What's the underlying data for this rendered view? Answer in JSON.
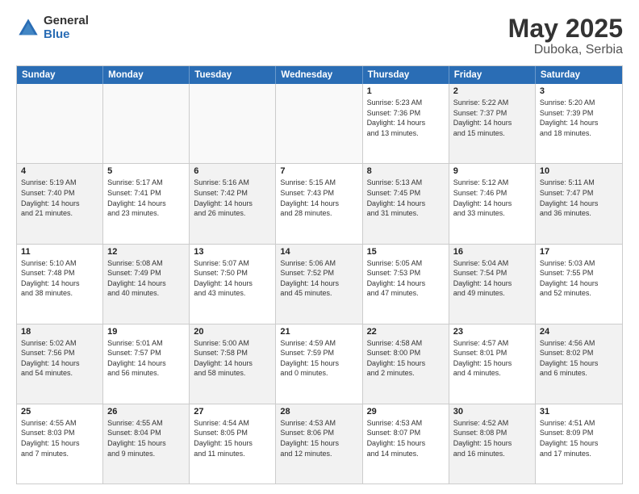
{
  "logo": {
    "general": "General",
    "blue": "Blue"
  },
  "title": "May 2025",
  "subtitle": "Duboka, Serbia",
  "header_days": [
    "Sunday",
    "Monday",
    "Tuesday",
    "Wednesday",
    "Thursday",
    "Friday",
    "Saturday"
  ],
  "weeks": [
    [
      {
        "day": "",
        "content": "",
        "empty": true
      },
      {
        "day": "",
        "content": "",
        "empty": true
      },
      {
        "day": "",
        "content": "",
        "empty": true
      },
      {
        "day": "",
        "content": "",
        "empty": true
      },
      {
        "day": "1",
        "content": "Sunrise: 5:23 AM\nSunset: 7:36 PM\nDaylight: 14 hours\nand 13 minutes.",
        "shaded": false
      },
      {
        "day": "2",
        "content": "Sunrise: 5:22 AM\nSunset: 7:37 PM\nDaylight: 14 hours\nand 15 minutes.",
        "shaded": true
      },
      {
        "day": "3",
        "content": "Sunrise: 5:20 AM\nSunset: 7:39 PM\nDaylight: 14 hours\nand 18 minutes.",
        "shaded": false
      }
    ],
    [
      {
        "day": "4",
        "content": "Sunrise: 5:19 AM\nSunset: 7:40 PM\nDaylight: 14 hours\nand 21 minutes.",
        "shaded": true
      },
      {
        "day": "5",
        "content": "Sunrise: 5:17 AM\nSunset: 7:41 PM\nDaylight: 14 hours\nand 23 minutes.",
        "shaded": false
      },
      {
        "day": "6",
        "content": "Sunrise: 5:16 AM\nSunset: 7:42 PM\nDaylight: 14 hours\nand 26 minutes.",
        "shaded": true
      },
      {
        "day": "7",
        "content": "Sunrise: 5:15 AM\nSunset: 7:43 PM\nDaylight: 14 hours\nand 28 minutes.",
        "shaded": false
      },
      {
        "day": "8",
        "content": "Sunrise: 5:13 AM\nSunset: 7:45 PM\nDaylight: 14 hours\nand 31 minutes.",
        "shaded": true
      },
      {
        "day": "9",
        "content": "Sunrise: 5:12 AM\nSunset: 7:46 PM\nDaylight: 14 hours\nand 33 minutes.",
        "shaded": false
      },
      {
        "day": "10",
        "content": "Sunrise: 5:11 AM\nSunset: 7:47 PM\nDaylight: 14 hours\nand 36 minutes.",
        "shaded": true
      }
    ],
    [
      {
        "day": "11",
        "content": "Sunrise: 5:10 AM\nSunset: 7:48 PM\nDaylight: 14 hours\nand 38 minutes.",
        "shaded": false
      },
      {
        "day": "12",
        "content": "Sunrise: 5:08 AM\nSunset: 7:49 PM\nDaylight: 14 hours\nand 40 minutes.",
        "shaded": true
      },
      {
        "day": "13",
        "content": "Sunrise: 5:07 AM\nSunset: 7:50 PM\nDaylight: 14 hours\nand 43 minutes.",
        "shaded": false
      },
      {
        "day": "14",
        "content": "Sunrise: 5:06 AM\nSunset: 7:52 PM\nDaylight: 14 hours\nand 45 minutes.",
        "shaded": true
      },
      {
        "day": "15",
        "content": "Sunrise: 5:05 AM\nSunset: 7:53 PM\nDaylight: 14 hours\nand 47 minutes.",
        "shaded": false
      },
      {
        "day": "16",
        "content": "Sunrise: 5:04 AM\nSunset: 7:54 PM\nDaylight: 14 hours\nand 49 minutes.",
        "shaded": true
      },
      {
        "day": "17",
        "content": "Sunrise: 5:03 AM\nSunset: 7:55 PM\nDaylight: 14 hours\nand 52 minutes.",
        "shaded": false
      }
    ],
    [
      {
        "day": "18",
        "content": "Sunrise: 5:02 AM\nSunset: 7:56 PM\nDaylight: 14 hours\nand 54 minutes.",
        "shaded": true
      },
      {
        "day": "19",
        "content": "Sunrise: 5:01 AM\nSunset: 7:57 PM\nDaylight: 14 hours\nand 56 minutes.",
        "shaded": false
      },
      {
        "day": "20",
        "content": "Sunrise: 5:00 AM\nSunset: 7:58 PM\nDaylight: 14 hours\nand 58 minutes.",
        "shaded": true
      },
      {
        "day": "21",
        "content": "Sunrise: 4:59 AM\nSunset: 7:59 PM\nDaylight: 15 hours\nand 0 minutes.",
        "shaded": false
      },
      {
        "day": "22",
        "content": "Sunrise: 4:58 AM\nSunset: 8:00 PM\nDaylight: 15 hours\nand 2 minutes.",
        "shaded": true
      },
      {
        "day": "23",
        "content": "Sunrise: 4:57 AM\nSunset: 8:01 PM\nDaylight: 15 hours\nand 4 minutes.",
        "shaded": false
      },
      {
        "day": "24",
        "content": "Sunrise: 4:56 AM\nSunset: 8:02 PM\nDaylight: 15 hours\nand 6 minutes.",
        "shaded": true
      }
    ],
    [
      {
        "day": "25",
        "content": "Sunrise: 4:55 AM\nSunset: 8:03 PM\nDaylight: 15 hours\nand 7 minutes.",
        "shaded": false
      },
      {
        "day": "26",
        "content": "Sunrise: 4:55 AM\nSunset: 8:04 PM\nDaylight: 15 hours\nand 9 minutes.",
        "shaded": true
      },
      {
        "day": "27",
        "content": "Sunrise: 4:54 AM\nSunset: 8:05 PM\nDaylight: 15 hours\nand 11 minutes.",
        "shaded": false
      },
      {
        "day": "28",
        "content": "Sunrise: 4:53 AM\nSunset: 8:06 PM\nDaylight: 15 hours\nand 12 minutes.",
        "shaded": true
      },
      {
        "day": "29",
        "content": "Sunrise: 4:53 AM\nSunset: 8:07 PM\nDaylight: 15 hours\nand 14 minutes.",
        "shaded": false
      },
      {
        "day": "30",
        "content": "Sunrise: 4:52 AM\nSunset: 8:08 PM\nDaylight: 15 hours\nand 16 minutes.",
        "shaded": true
      },
      {
        "day": "31",
        "content": "Sunrise: 4:51 AM\nSunset: 8:09 PM\nDaylight: 15 hours\nand 17 minutes.",
        "shaded": false
      }
    ]
  ]
}
